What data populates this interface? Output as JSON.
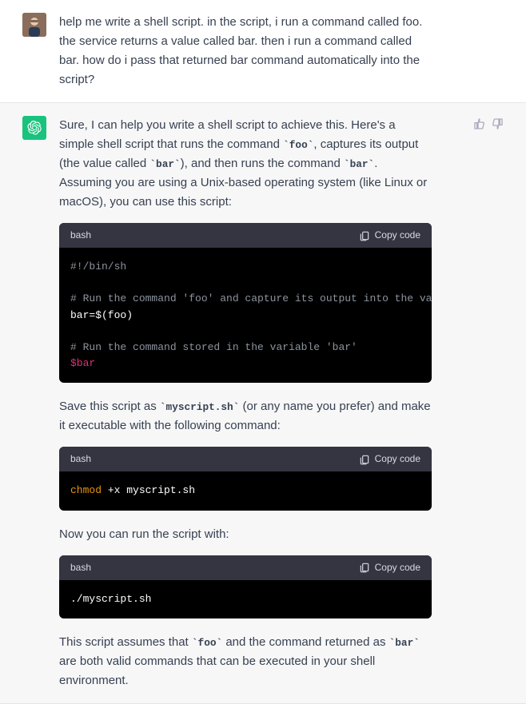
{
  "user_msg": {
    "text": "help me write a shell script. in the script, i run a command called foo. the service returns a value called bar. then i run a command called bar. how do i pass that returned bar command automatically into the script?"
  },
  "assistant": {
    "intro_a": "Sure, I can help you write a shell script to achieve this. Here's a simple shell script that runs the command ",
    "intro_code1": "`foo`",
    "intro_b": ", captures its output (the value called ",
    "intro_code2": "`bar`",
    "intro_c": "), and then runs the command ",
    "intro_code3": "`bar`",
    "intro_d": ". Assuming you are using a Unix-based operating system (like Linux or macOS), you can use this script:",
    "block1": {
      "lang": "bash",
      "copy": "Copy code",
      "l1": "#!/bin/sh",
      "l2": "# Run the command 'foo' and capture its output into the variable 'bar'",
      "l3": "bar=$(foo)",
      "l4": "# Run the command stored in the variable 'bar'",
      "l5": "$bar"
    },
    "mid1_a": "Save this script as ",
    "mid1_code": "`myscript.sh`",
    "mid1_b": " (or any name you prefer) and make it executable with the following command:",
    "block2": {
      "lang": "bash",
      "copy": "Copy code",
      "cmd": "chmod",
      "args": " +x myscript.sh"
    },
    "mid2": "Now you can run the script with:",
    "block3": {
      "lang": "bash",
      "copy": "Copy code",
      "line": "./myscript.sh"
    },
    "outro_a": "This script assumes that ",
    "outro_code1": "`foo`",
    "outro_b": " and the command returned as ",
    "outro_code2": "`bar`",
    "outro_c": " are both valid commands that can be executed in your shell environment."
  },
  "chart_data": null
}
